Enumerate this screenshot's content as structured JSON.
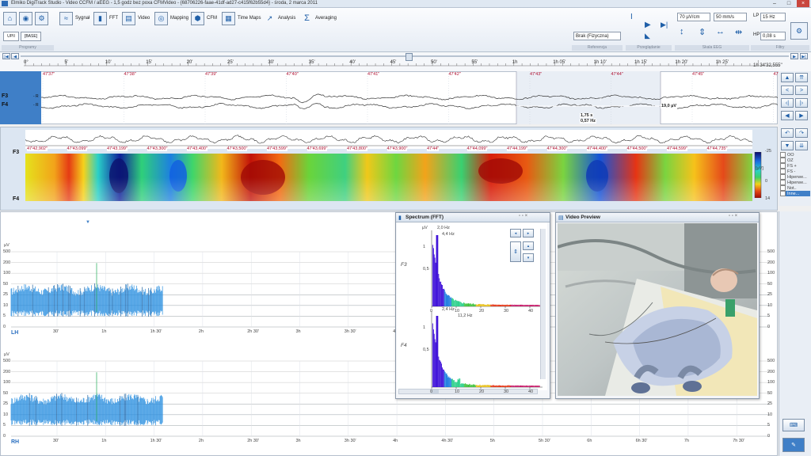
{
  "window": {
    "title": "Elmiko DigiTrack Studio  -  Video CCFM / aEEG  -  1,5 godz bez poxa CFMVideo  -  {68706226-faae-41df-ad27-c415f62b55d4}  -  środa, 2 marca 2011",
    "controls": [
      "–",
      "□",
      "×"
    ]
  },
  "toolbar": {
    "sygnal": "Sygnał",
    "fft": "FFT",
    "video": "Video",
    "mapping": "Mapping",
    "cfm": "CFM",
    "time_maps": "Time Maps",
    "analysis": "Analysis",
    "averaging": "Averaging",
    "tab_upm": "UPII",
    "tab_base": "[BASE]",
    "group_programy": "Programy",
    "reference_value": "Brak (Fizyczna)",
    "group_referencja": "Referencja",
    "group_przegladanie": "Przeglądanie",
    "sensitivity_value": "70 µV/cm",
    "speed_value": "50 mm/s",
    "group_skala": "Skala EEG",
    "lp_label": "LP",
    "lp_value": "15 Hz",
    "hp_label": "HP",
    "hp_value": "0,08 s",
    "group_filtry": "Filtry"
  },
  "timeline": {
    "ticks": [
      "0°",
      "5'",
      "10'",
      "15'",
      "20'",
      "25'",
      "30'",
      "35'",
      "40'",
      "45'",
      "50'",
      "55'",
      "1h",
      "1h 05'",
      "1h 10'",
      "1h 15'",
      "1h 20'",
      "1h 25'"
    ],
    "end_label": "1h 34'32,555''"
  },
  "eeg": {
    "time_marks": [
      "47'37\"",
      "47'38\"",
      "47'39\"",
      "47'40\"",
      "47'41\"",
      "47'42\"",
      "47'43\"",
      "47'44\"",
      "47'45\"",
      "47'46\""
    ],
    "channels": [
      {
        "name": "F3",
        "suffix": "- R"
      },
      {
        "name": "F4",
        "suffix": "- R"
      }
    ],
    "measure_time": "1,75 s",
    "measure_freq": "0,57 Hz",
    "measure_amp": "19,0 µV",
    "measure_marks": [
      "6",
      "7",
      "8",
      "9"
    ]
  },
  "cfm": {
    "channel_top": "F3",
    "channel_bottom": "F4",
    "time_marks": [
      "47'42,902\"",
      "47'43,099\"",
      "47'43,199\"",
      "47'43,300\"",
      "47'43,400\"",
      "47'43,500\"",
      "47'43,599\"",
      "47'43,699\"",
      "47'43,800\"",
      "47'43,900\"",
      "47'44\"",
      "47'44,099\"",
      "47'44,199\"",
      "47'44,300\"",
      "47'44,400\"",
      "47'44,500\"",
      "47'44,599\"",
      "47'44,735\""
    ],
    "scale_labels": [
      "-25",
      "[µV]",
      "0",
      "14"
    ]
  },
  "right_panel": {
    "checkboxes": [
      "OO",
      "OZ",
      "FS +",
      "FS -",
      "Hiperwe...",
      "Hiperwe...",
      "Not..",
      "Inne..."
    ]
  },
  "trend": {
    "unit": "µV",
    "y_labels": [
      "500",
      "200",
      "100",
      "50",
      "25",
      "10",
      "5",
      "0"
    ],
    "lh_label": "LH",
    "rh_label": "RH",
    "x_labels": [
      "30'",
      "1h",
      "1h 30'",
      "2h",
      "2h 30'",
      "3h",
      "3h 30'",
      "4h",
      "4h 30'",
      "5h",
      "5h 30'",
      "6h",
      "6h 30'",
      "7h",
      "7h 30'"
    ]
  },
  "spectrum": {
    "title": "Spectrum (FFT)",
    "unit": "µV",
    "ch1": "F3",
    "ch2": "F4",
    "f3_peak1": "2,0 Hz",
    "f3_peak2": "4,4 Hz",
    "f4_peak1": "2,4 Hz",
    "f4_peak2": "11,2 Hz",
    "x_ticks": [
      "0",
      "10",
      "20",
      "30",
      "40"
    ],
    "y_ticks": [
      "1",
      "0,5"
    ]
  },
  "video": {
    "title": "Video Preview"
  },
  "colors": {
    "accent": "#3f7fc7",
    "toolbar_bg": "#e6ecf4",
    "trend_fill": "#2a8fe0"
  }
}
